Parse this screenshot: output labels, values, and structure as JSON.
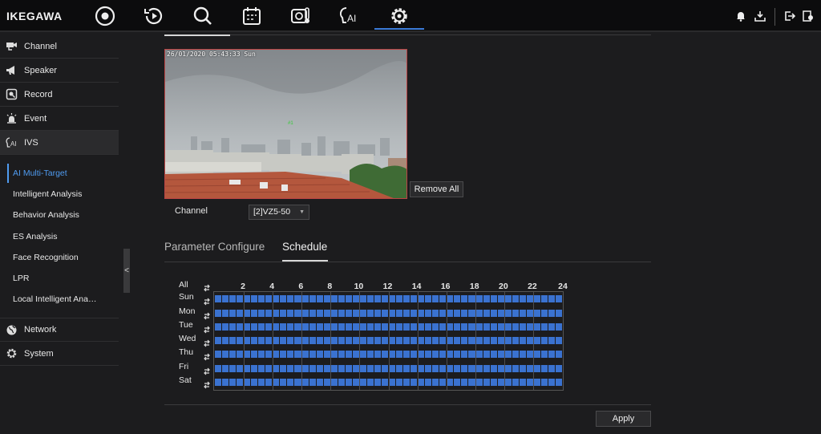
{
  "app": {
    "logo": "IKEGAWA"
  },
  "topnav": {
    "items": [
      {
        "name": "live-view",
        "icon": "live-view-icon"
      },
      {
        "name": "playback",
        "icon": "playback-icon"
      },
      {
        "name": "search",
        "icon": "search-icon"
      },
      {
        "name": "schedule",
        "icon": "calendar-icon"
      },
      {
        "name": "thermal",
        "icon": "thermal-camera-icon"
      },
      {
        "name": "ai",
        "icon": "ai-icon",
        "text": "AI"
      },
      {
        "name": "settings",
        "icon": "gear-icon",
        "active": true
      }
    ],
    "right": [
      "bell-icon",
      "download-icon",
      "logout-icon",
      "lock-screen-icon"
    ]
  },
  "sidebar": {
    "items": [
      {
        "label": "Channel",
        "icon": "camera-icon"
      },
      {
        "label": "Speaker",
        "icon": "megaphone-icon"
      },
      {
        "label": "Record",
        "icon": "record-icon"
      },
      {
        "label": "Event",
        "icon": "alarm-icon"
      },
      {
        "label": "IVS",
        "icon": "ai-icon"
      },
      {
        "label": "Network",
        "icon": "globe-icon"
      },
      {
        "label": "System",
        "icon": "gear-icon"
      }
    ],
    "subitems": [
      "AI Multi-Target",
      "Intelligent Analysis",
      "Behavior Analysis",
      "ES Analysis",
      "Face Recognition",
      "LPR",
      "Local Intelligent Ana…"
    ],
    "collapse": "<"
  },
  "video": {
    "timestamp": "26/01/2020 05:43:33 Sun"
  },
  "buttons": {
    "remove_all": "Remove All",
    "apply": "Apply"
  },
  "channel": {
    "label": "Channel",
    "value": "[2]VZ5-50"
  },
  "tabs": [
    {
      "label": "Parameter Configure",
      "active": false
    },
    {
      "label": "Schedule",
      "active": true
    }
  ],
  "schedule": {
    "all_label": "All",
    "days": [
      "Sun",
      "Mon",
      "Tue",
      "Wed",
      "Thu",
      "Fri",
      "Sat"
    ],
    "hours": [
      "2",
      "4",
      "6",
      "8",
      "10",
      "12",
      "14",
      "16",
      "18",
      "20",
      "22",
      "24"
    ],
    "enabled_color": "#3a72d0",
    "all_enabled": true
  },
  "colors": {
    "accent": "#3b7bd8",
    "sub_active": "#4f9bf0"
  }
}
